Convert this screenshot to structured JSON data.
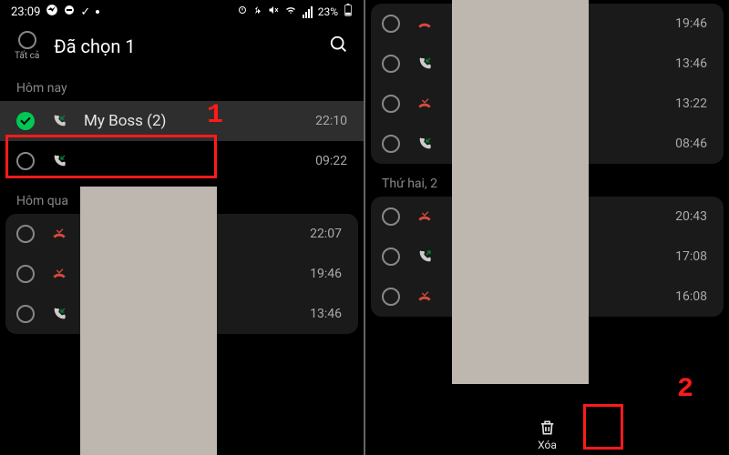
{
  "status": {
    "time": "23:09",
    "battery": "23%"
  },
  "header": {
    "select_all": "Tất cả",
    "title": "Đã chọn 1"
  },
  "annotations": {
    "one": "1",
    "two": "2"
  },
  "left": {
    "sections": {
      "today": "Hôm nay",
      "yesterday": "Hôm qua"
    },
    "rows": {
      "r0": {
        "name": "My Boss (2)",
        "time": "22:10"
      },
      "r1": {
        "time": "09:22"
      },
      "r2": {
        "time": "22:07"
      },
      "r3": {
        "time": "19:46"
      },
      "r4": {
        "time": "13:46"
      }
    }
  },
  "right": {
    "section_mon": "Thứ hai, 2",
    "rows": {
      "r0": {
        "time": "19:46"
      },
      "r1": {
        "time": "13:46"
      },
      "r2": {
        "time": "13:22"
      },
      "r3": {
        "time": "08:46"
      },
      "r4": {
        "time": "20:43"
      },
      "r5": {
        "time": "17:08"
      },
      "r6": {
        "time": "16:08"
      }
    },
    "delete_label": "Xóa"
  }
}
